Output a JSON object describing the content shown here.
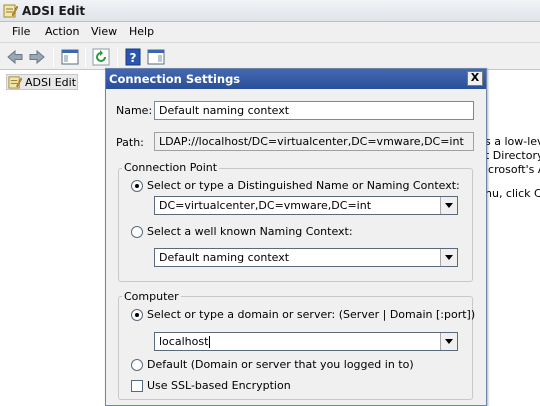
{
  "app": {
    "title": "ADSI Edit"
  },
  "menu": {
    "items": [
      "File",
      "Action",
      "View",
      "Help"
    ]
  },
  "tree": {
    "root_label": "ADSI Edit"
  },
  "background_text": [
    "s a low-leve",
    "t Directory",
    "icrosoft's A",
    "nu, click Co"
  ],
  "dialog": {
    "title": "Connection Settings",
    "close_glyph": "X",
    "name_label": "Name:",
    "name_value": "Default naming context",
    "path_label": "Path:",
    "path_value": "LDAP://localhost/DC=virtualcenter,DC=vmware,DC=int",
    "connection_point": {
      "legend": "Connection Point",
      "option_dn_label": "Select or type a Distinguished Name or Naming Context:",
      "dn_value": "DC=virtualcenter,DC=vmware,DC=int",
      "option_wellknown_label": "Select a well known Naming Context:",
      "wellknown_value": "Default naming context",
      "selected": "dn"
    },
    "computer": {
      "legend": "Computer",
      "option_server_label": "Select or type a domain or server: (Server | Domain [:port])",
      "server_value": "localhost",
      "option_default_label": "Default (Domain or server that you logged in to)",
      "ssl_label": "Use SSL-based Encryption",
      "ssl_checked": false,
      "selected": "server"
    }
  },
  "colors": {
    "dialog_title": "#2a4f9a",
    "window_bg": "#f0f0f0"
  }
}
